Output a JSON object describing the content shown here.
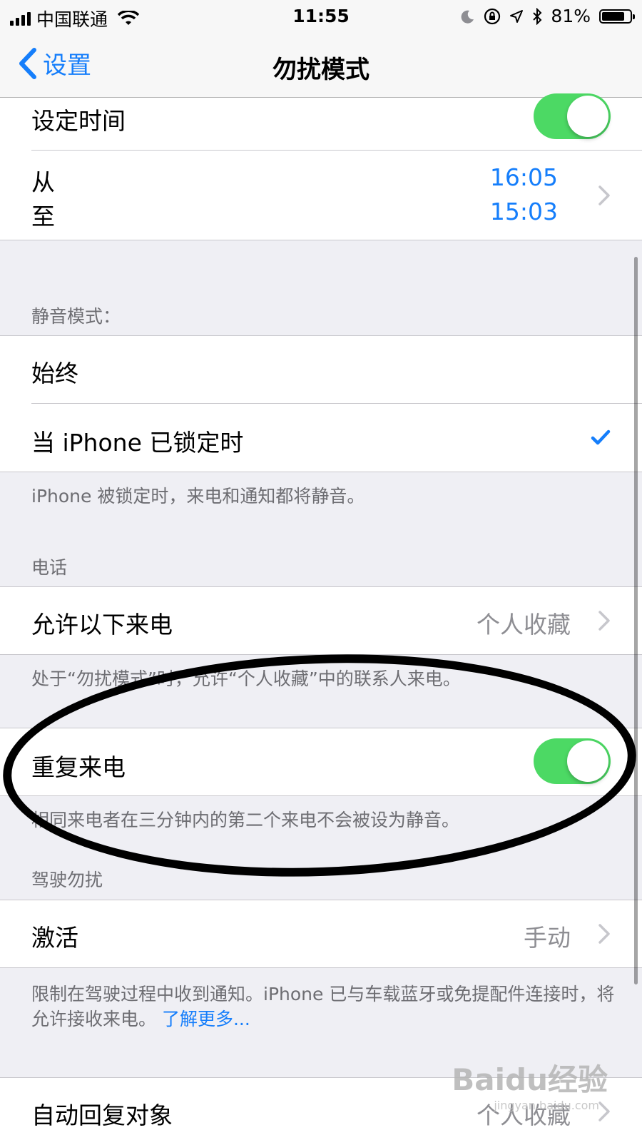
{
  "status_bar": {
    "carrier": "中国联通",
    "time": "11:55",
    "battery": "81%",
    "battery_level": 0.81
  },
  "nav": {
    "back_label": "设置",
    "title": "勿扰模式"
  },
  "schedule": {
    "scheduled_label": "设定时间",
    "scheduled_on": true,
    "from_label": "从",
    "to_label": "至",
    "from_time": "16:05",
    "to_time": "15:03"
  },
  "silence": {
    "header": "静音模式：",
    "always_label": "始终",
    "locked_label": "当 iPhone 已锁定时",
    "selected": "locked",
    "footer": "iPhone 被锁定时，来电和通知都将静音。"
  },
  "phone": {
    "header": "电话",
    "allow_calls_label": "允许以下来电",
    "allow_calls_value": "个人收藏",
    "allow_calls_footer": "处于“勿扰模式”时，允许“个人收藏”中的联系人来电。",
    "repeated_calls_label": "重复来电",
    "repeated_calls_on": true,
    "repeated_calls_footer": "相同来电者在三分钟内的第二个来电不会被设为静音。"
  },
  "driving": {
    "header": "驾驶勿扰",
    "activate_label": "激活",
    "activate_value": "手动",
    "footer": "限制在驾驶过程中收到通知。iPhone 已与车载蓝牙或免提配件连接时，将允许接收来电。",
    "learn_more": "了解更多..."
  },
  "auto_reply": {
    "label": "自动回复对象",
    "value": "个人收藏"
  },
  "watermark": {
    "brand": "Baidu经验",
    "url": "jingyan.baidu.com"
  }
}
